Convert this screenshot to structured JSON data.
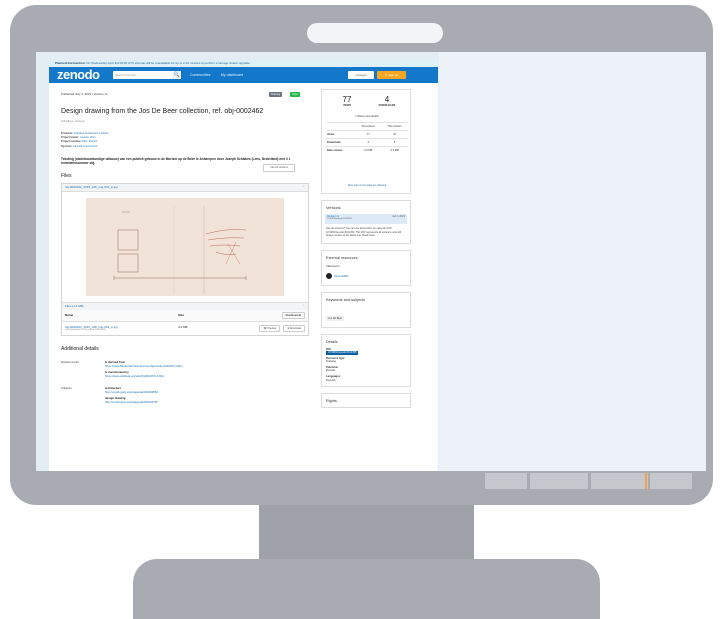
{
  "banner": {
    "label": "Planned intervention",
    "text": "On Wednesday April 3rd 06:00 UTC Zenodo will be unavailable for up to 2-10 minutes to perform a storage cluster upgrade."
  },
  "header": {
    "logo": "zenodo",
    "search_placeholder": "Search records...",
    "search_icon": "🔍",
    "nav": [
      "Communities",
      "My dashboard"
    ],
    "login_label": "⇥ Log in",
    "signup_label": "✎ Sign up"
  },
  "record": {
    "published": "Published July 4, 2023 | Version v1",
    "badges": [
      {
        "label": "Drawing",
        "color": "#6b7280"
      },
      {
        "label": "Open",
        "color": "#21ba45"
      }
    ],
    "title": "Design drawing from the Jos De Beer collection, ref. obj-0002462",
    "authors": "Schalkes, Joseph",
    "meta": [
      {
        "label": "Producer:",
        "value": "Flanders Architecture Institute"
      },
      {
        "label": "Project leader:",
        "value": "Lowette, Wim"
      },
      {
        "label": "Project member:",
        "value": "Pitts, Vincent"
      },
      {
        "label": "Sponsor:",
        "value": "Flemish Government"
      }
    ],
    "cite_label": "Cite all versions",
    "description": "Teksting (stedebouwkundige uitbouw) van een publiek gebouw in de Mortsel op de Beke te Antwerpen door Joseph Schalkes (Lens, Nederland) met 3 1 Inventarisnummer obj.",
    "files_heading": "Files",
    "file_name": "obj-0002462_3035_038_img-001_A.jpg",
    "files_count": "Files (4.4 MB)",
    "table_headers": [
      "Name",
      "Size",
      "Download all"
    ],
    "file_row": {
      "name": "obj-0002462_3035_038_img-001_A.jpg",
      "md5": "md5:4b0de3f6e7c12f4caf9aab7e7d28a9f1",
      "size": "4.4 MB",
      "preview": "Preview",
      "download": "Download"
    },
    "additional_heading": "Additional details",
    "related_label": "Related works",
    "related": [
      {
        "key": "Is derived from",
        "value": "https://www.flandersarchitecture.be/objects/obj-0002462 (URL)"
      },
      {
        "key": "Is documented by",
        "value": "https://www.wikidata.org/wiki/Q12019379 (URL)"
      }
    ],
    "subjects_label": "Subjects",
    "subjects": [
      {
        "key": "architecture",
        "value": "http://vocab.getty.edu/page/aat/300263552"
      },
      {
        "key": "design drawing",
        "value": "http://vocab.getty.edu/page/aat/300034787"
      }
    ]
  },
  "stats": {
    "views": "77",
    "views_label": "VIEWS",
    "downloads": "4",
    "downloads_label": "DOWNLOADS",
    "more_details": "Show more details",
    "col_headers": [
      "",
      "All versions",
      "This version"
    ],
    "rows": [
      {
        "label": "Views",
        "all": "77",
        "this": "76"
      },
      {
        "label": "Downloads",
        "all": "4",
        "this": "4"
      },
      {
        "label": "Data volume",
        "all": "9.3 MB",
        "this": "9.3 MB"
      }
    ],
    "footer": "More info on how stats are collected"
  },
  "versions": {
    "heading": "Versions",
    "current": "Version v1",
    "current_doi": "10.5281/zenodo.8121455",
    "current_date": "Jul 4, 2023",
    "note": "Cite all versions? You can cite all versions by using the DOI 10.5281/zenodo.8121454. This DOI represents all versions, and will always resolve to the latest one. Read more."
  },
  "external": {
    "heading": "External resources",
    "indexed_in": "Indexed in",
    "source": "OpenAIRE"
  },
  "keywords": {
    "heading": "Keywords and subjects",
    "tag": "Jos De Beer"
  },
  "details": {
    "heading": "Details",
    "doi_label": "DOI",
    "doi": "10.5281/zenodo.8121455",
    "resource_type_label": "Resource type",
    "resource_type": "Drawing",
    "publisher_label": "Publisher",
    "publisher": "Zenodo",
    "languages_label": "Languages",
    "languages": "Flemish"
  },
  "rights": {
    "heading": "Rights"
  },
  "colors": {
    "header_blue": "#1378c9",
    "signup_orange": "#f6a623",
    "link_blue": "#1a6fb0",
    "monitor_gray": "#a9abb3"
  }
}
